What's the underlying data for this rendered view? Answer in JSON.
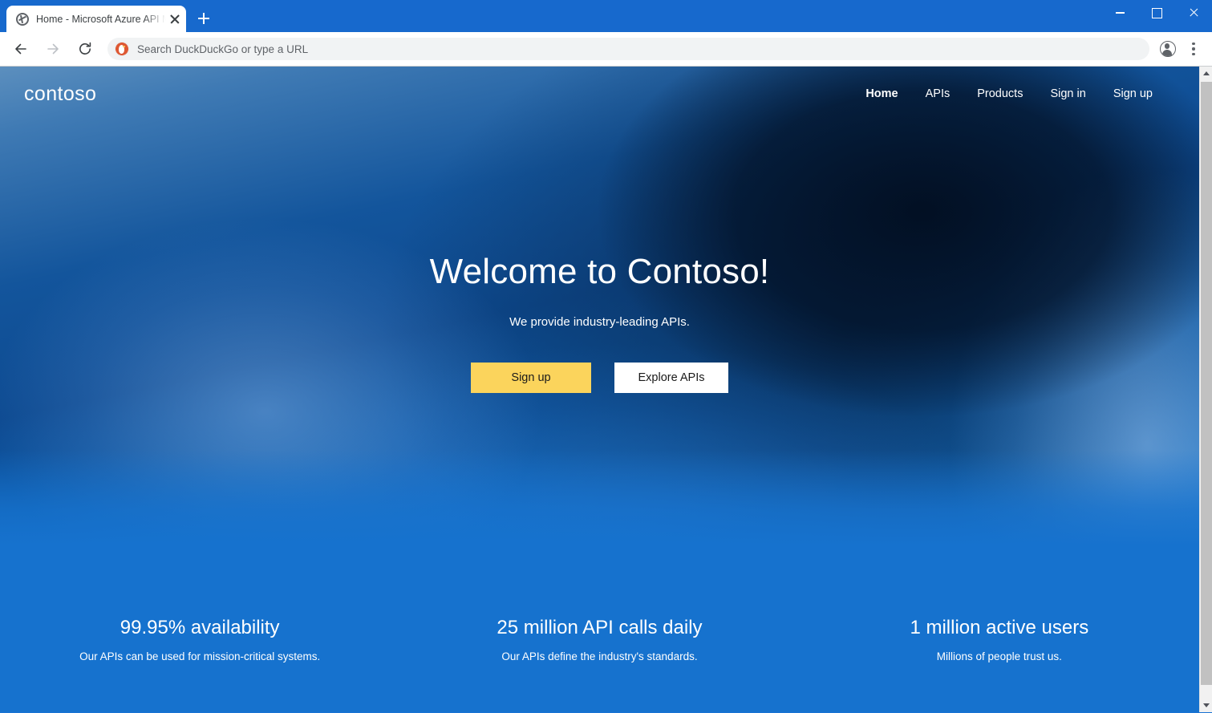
{
  "browser": {
    "tab": {
      "title": "Home - Microsoft Azure API Man",
      "favicon": "globe-icon",
      "close": "close-icon"
    },
    "new_tab_label": "+",
    "window_controls": {
      "minimize": "minimize-icon",
      "maximize": "maximize-icon",
      "close": "close-icon"
    },
    "toolbar": {
      "back": "back-arrow-icon",
      "forward": "forward-arrow-icon",
      "reload": "reload-icon",
      "omnibox_placeholder": "Search DuckDuckGo or type a URL",
      "omnibox_value": "",
      "search_engine_icon": "duckduckgo-icon",
      "profile": "account-avatar-icon",
      "menu": "three-dot-menu-icon"
    },
    "scrollbar": {
      "up": "scroll-up-arrow-icon",
      "down": "scroll-down-arrow-icon"
    }
  },
  "site": {
    "logo": "contoso",
    "nav": [
      {
        "label": "Home",
        "active": true
      },
      {
        "label": "APIs",
        "active": false
      },
      {
        "label": "Products",
        "active": false
      },
      {
        "label": "Sign in",
        "active": false
      },
      {
        "label": "Sign up",
        "active": false
      }
    ],
    "hero": {
      "title": "Welcome to Contoso!",
      "subtitle": "We provide industry-leading APIs.",
      "primary_button": "Sign up",
      "secondary_button": "Explore APIs"
    },
    "stats": [
      {
        "value": "99.95% availability",
        "description": "Our APIs can be used for mission-critical systems."
      },
      {
        "value": "25 million API calls daily",
        "description": "Our APIs define the industry's standards."
      },
      {
        "value": "1 million active users",
        "description": "Millions of people trust us."
      }
    ]
  },
  "colors": {
    "brand_blue": "#1672ce",
    "accent_yellow": "#fbd45c",
    "chrome_blue": "#1769cd",
    "hero_dark": "#0d4a91"
  }
}
